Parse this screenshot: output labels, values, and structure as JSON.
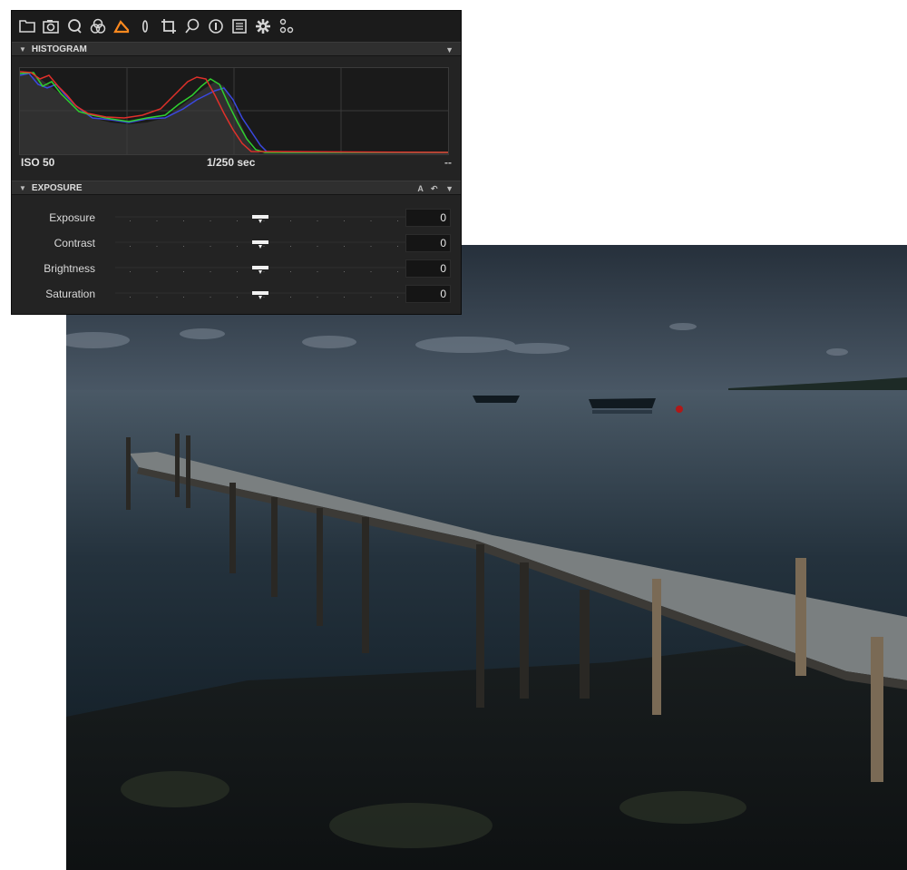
{
  "toolbar": {
    "tools": [
      {
        "name": "folder-icon"
      },
      {
        "name": "camera-icon"
      },
      {
        "name": "quick-icon"
      },
      {
        "name": "color-icon"
      },
      {
        "name": "exposure-icon",
        "active": true
      },
      {
        "name": "lens-icon"
      },
      {
        "name": "crop-icon"
      },
      {
        "name": "details-icon"
      },
      {
        "name": "local-adjustments-icon"
      },
      {
        "name": "metadata-icon"
      },
      {
        "name": "settings-icon"
      },
      {
        "name": "batch-icon"
      }
    ],
    "active_color": "#ff8a1f"
  },
  "histogram": {
    "header": "HISTOGRAM",
    "iso": "ISO 50",
    "shutter": "1/250 sec",
    "aperture": "--"
  },
  "exposure": {
    "header": "EXPOSURE",
    "auto_label": "A",
    "sliders": [
      {
        "label": "Exposure",
        "value": "0"
      },
      {
        "label": "Contrast",
        "value": "0"
      },
      {
        "label": "Brightness",
        "value": "0"
      },
      {
        "label": "Saturation",
        "value": "0"
      }
    ]
  },
  "colors": {
    "panel_bg": "#232323",
    "hist_red": "#e0302a",
    "hist_green": "#2fd12f",
    "hist_blue": "#3a48e0"
  }
}
